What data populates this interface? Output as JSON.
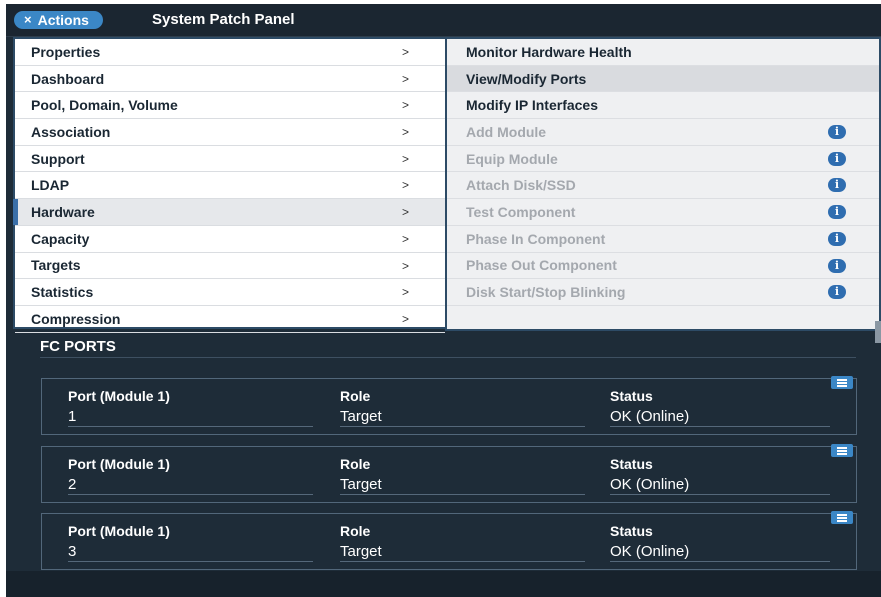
{
  "header": {
    "actions_label": "Actions",
    "actions_close_glyph": "×",
    "title": "System Patch Panel"
  },
  "menu": {
    "chevron": ">",
    "items": [
      {
        "label": "Properties"
      },
      {
        "label": "Dashboard"
      },
      {
        "label": "Pool, Domain, Volume"
      },
      {
        "label": "Association"
      },
      {
        "label": "Support"
      },
      {
        "label": "LDAP"
      },
      {
        "label": "Hardware"
      },
      {
        "label": "Capacity"
      },
      {
        "label": "Targets"
      },
      {
        "label": "Statistics"
      },
      {
        "label": "Compression"
      }
    ],
    "active": "Hardware"
  },
  "submenu": {
    "info_glyph": "i",
    "items": [
      {
        "label": "Monitor Hardware Health",
        "enabled": true
      },
      {
        "label": "View/Modify Ports",
        "enabled": true
      },
      {
        "label": "Modify IP Interfaces",
        "enabled": true
      },
      {
        "label": "Add Module",
        "enabled": false
      },
      {
        "label": "Equip Module",
        "enabled": false
      },
      {
        "label": "Attach Disk/SSD",
        "enabled": false
      },
      {
        "label": "Test Component",
        "enabled": false
      },
      {
        "label": "Phase In Component",
        "enabled": false
      },
      {
        "label": "Phase Out Component",
        "enabled": false
      },
      {
        "label": "Disk Start/Stop Blinking",
        "enabled": false
      }
    ],
    "hovered": "View/Modify Ports"
  },
  "fc_ports": {
    "title": "FC PORTS",
    "headers": {
      "port": "Port (Module 1)",
      "role": "Role",
      "status": "Status"
    },
    "rows": [
      {
        "port": "1",
        "role": "Target",
        "status": "OK (Online)"
      },
      {
        "port": "2",
        "role": "Target",
        "status": "OK (Online)"
      },
      {
        "port": "3",
        "role": "Target",
        "status": "OK (Online)"
      }
    ]
  },
  "colors": {
    "background": "#1e2c38",
    "accent": "#3b87c6",
    "menu_border": "#2d4b66",
    "disabled_text": "#a4a8ae"
  }
}
